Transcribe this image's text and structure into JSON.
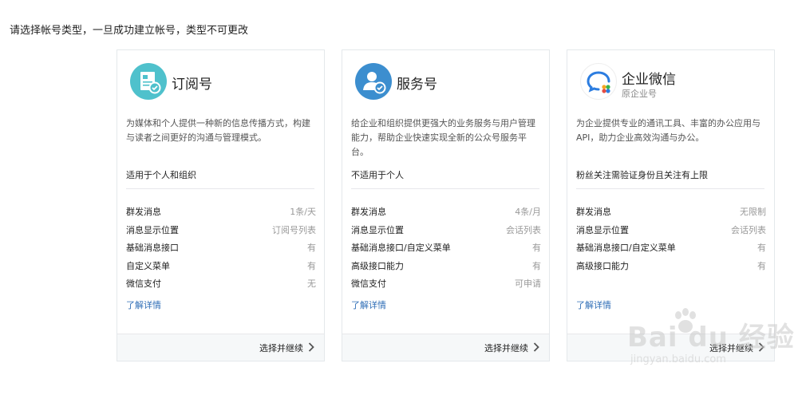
{
  "page": {
    "title": "请选择帐号类型，一旦成功建立帐号，类型不可更改"
  },
  "cards": [
    {
      "name": "订阅号",
      "subname": "",
      "icon": "subscription-document-icon",
      "icon_color": "#4fc1cc",
      "description": "为媒体和个人提供一种新的信息传播方式，构建与读者之间更好的沟通与管理模式。",
      "audience": "适用于个人和组织",
      "features": [
        {
          "name": "群发消息",
          "value": "1条/天"
        },
        {
          "name": "消息显示位置",
          "value": "订阅号列表"
        },
        {
          "name": "基础消息接口",
          "value": "有"
        },
        {
          "name": "自定义菜单",
          "value": "有"
        },
        {
          "name": "微信支付",
          "value": "无"
        }
      ],
      "learn_more": "了解详情",
      "select_label": "选择并继续"
    },
    {
      "name": "服务号",
      "subname": "",
      "icon": "service-user-icon",
      "icon_color": "#3c8ecf",
      "description": "给企业和组织提供更强大的业务服务与用户管理能力，帮助企业快速实现全新的公众号服务平台。",
      "audience": "不适用于个人",
      "features": [
        {
          "name": "群发消息",
          "value": "4条/月"
        },
        {
          "name": "消息显示位置",
          "value": "会话列表"
        },
        {
          "name": "基础消息接口/自定义菜单",
          "value": "有"
        },
        {
          "name": "高级接口能力",
          "value": "有"
        },
        {
          "name": "微信支付",
          "value": "可申请"
        }
      ],
      "learn_more": "了解详情",
      "select_label": "选择并继续"
    },
    {
      "name": "企业微信",
      "subname": "原企业号",
      "icon": "wecom-chat-icon",
      "icon_color": "#2c7de0",
      "description": "为企业提供专业的通讯工具、丰富的办公应用与API，助力企业高效沟通与办公。",
      "audience": "粉丝关注需验证身份且关注有上限",
      "features": [
        {
          "name": "群发消息",
          "value": "无限制"
        },
        {
          "name": "消息显示位置",
          "value": "会话列表"
        },
        {
          "name": "基础消息接口/自定义菜单",
          "value": "有"
        },
        {
          "name": "高级接口能力",
          "value": "有"
        }
      ],
      "learn_more": "了解详情",
      "select_label": "选择并继续"
    }
  ],
  "watermark": {
    "brand": "Bai du 经验",
    "url": "jingyan.baidu.com"
  }
}
